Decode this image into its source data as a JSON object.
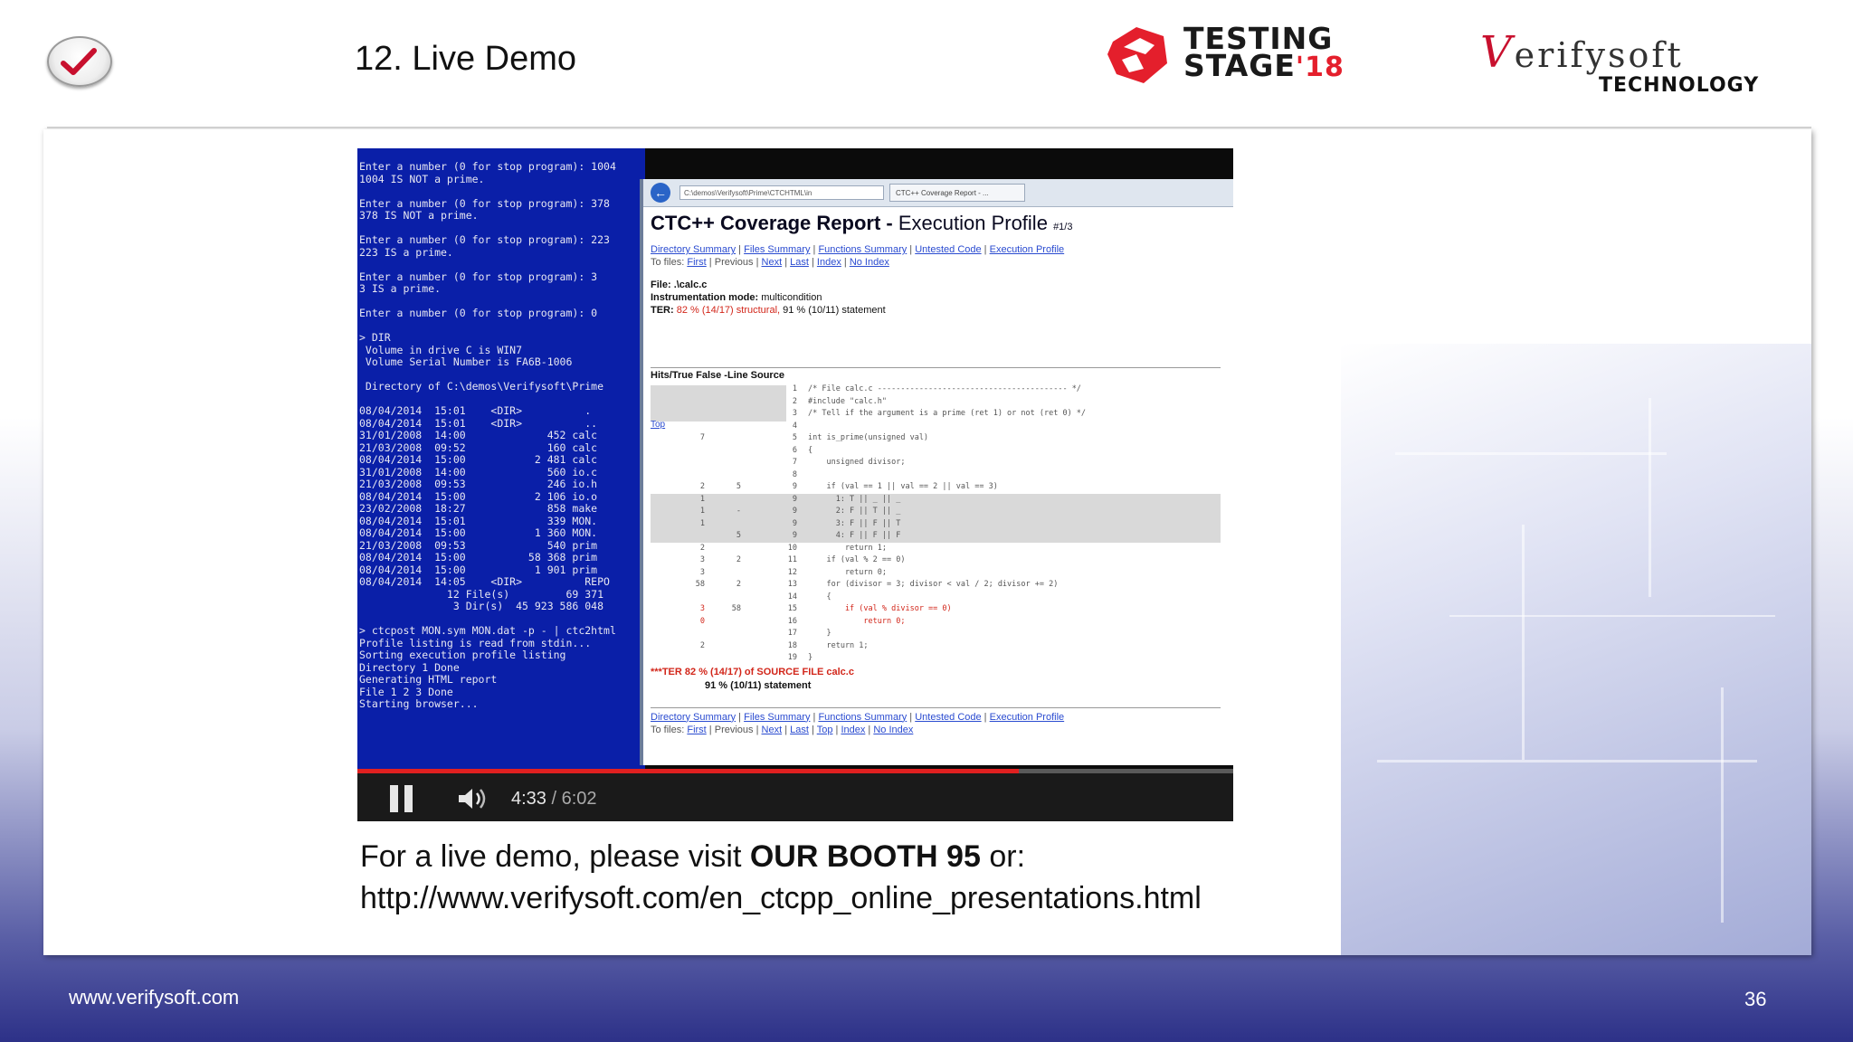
{
  "header": {
    "slide_title": "12. Live Demo",
    "testing_stage_line1": "TESTING",
    "testing_stage_line2": "STAGE",
    "testing_stage_year": "'18",
    "verifysoft_name": "erifysoft",
    "verifysoft_v": "V",
    "verifysoft_tagline": "TECHNOLOGY"
  },
  "video": {
    "terminal_lines": [
      "Enter a number (0 for stop program): 1004",
      "1004 IS NOT a prime.",
      "",
      "Enter a number (0 for stop program): 378",
      "378 IS NOT a prime.",
      "",
      "Enter a number (0 for stop program): 223",
      "223 IS a prime.",
      "",
      "Enter a number (0 for stop program): 3",
      "3 IS a prime.",
      "",
      "Enter a number (0 for stop program): 0",
      "",
      "> DIR",
      " Volume in drive C is WIN7",
      " Volume Serial Number is FA6B-1006",
      "",
      " Directory of C:\\demos\\Verifysoft\\Prime",
      "",
      "08/04/2014  15:01    <DIR>          .",
      "08/04/2014  15:01    <DIR>          ..",
      "31/01/2008  14:00             452 calc",
      "21/03/2008  09:52             160 calc",
      "08/04/2014  15:00           2 481 calc",
      "31/01/2008  14:00             560 io.c",
      "21/03/2008  09:53             246 io.h",
      "08/04/2014  15:00           2 106 io.o",
      "23/02/2008  18:27             858 make",
      "08/04/2014  15:01             339 MON.",
      "08/04/2014  15:00           1 360 MON.",
      "21/03/2008  09:53             540 prim",
      "08/04/2014  15:00          58 368 prim",
      "08/04/2014  15:00           1 901 prim",
      "08/04/2014  14:05    <DIR>          REPO",
      "              12 File(s)         69 371",
      "               3 Dir(s)  45 923 586 048",
      "",
      "> ctcpost MON.sym MON.dat -p - | ctc2html",
      "Profile listing is read from stdin...",
      "Sorting execution profile listing",
      "Directory 1 Done",
      "Generating HTML report",
      "File 1 2 3 Done",
      "Starting browser..."
    ],
    "browser_address": "C:\\demos\\Verifysoft\\Prime\\CTCHTML\\in",
    "browser_tab": "CTC++ Coverage Report - ...",
    "report_title": "CTC++ Coverage Report - ",
    "report_subtitle": "Execution Profile",
    "report_page": "#1/3",
    "nav_links": [
      "Directory Summary",
      "Files Summary",
      "Functions Summary",
      "Untested Code",
      "Execution Profile"
    ],
    "file_links": [
      "To files:",
      "First",
      "Previous",
      "Next",
      "Last",
      "Index",
      "No Index"
    ],
    "file_label": "File:",
    "file_value": ".\\calc.c",
    "instr_label": "Instrumentation mode:",
    "instr_value": "multicondition",
    "ter_label": "TER:",
    "ter_structural": "82 % (14/17) structural,",
    "ter_statement": "91 % (10/11) statement",
    "table_header": "Hits/True False -Line Source",
    "top_link": "Top",
    "code_lines": [
      {
        "hits": "",
        "false": "",
        "line": "1",
        "src": "/* File calc.c ----------------------------------------- */"
      },
      {
        "hits": "",
        "false": "",
        "line": "2",
        "src": "#include \"calc.h\""
      },
      {
        "hits": "",
        "false": "",
        "line": "3",
        "src": "/* Tell if the argument is a prime (ret 1) or not (ret 0) */"
      },
      {
        "hits": "",
        "false": "",
        "line": "4",
        "src": ""
      },
      {
        "hits": "7",
        "false": "",
        "line": "5",
        "src": "int is_prime(unsigned val)"
      },
      {
        "hits": "",
        "false": "",
        "line": "6",
        "src": "{"
      },
      {
        "hits": "",
        "false": "",
        "line": "7",
        "src": "    unsigned divisor;"
      },
      {
        "hits": "",
        "false": "",
        "line": "8",
        "src": ""
      },
      {
        "hits": "2",
        "false": "5",
        "line": "9",
        "src": "    if (val == 1 || val == 2 || val == 3)"
      },
      {
        "hits": "1",
        "false": "",
        "line": "9",
        "src": "      1: T || _ || _"
      },
      {
        "hits": "1",
        "false": "-",
        "line": "9",
        "src": "      2: F || T || _"
      },
      {
        "hits": "1",
        "false": "",
        "line": "9",
        "src": "      3: F || F || T"
      },
      {
        "hits": "",
        "false": "5",
        "line": "9",
        "src": "      4: F || F || F"
      },
      {
        "hits": "2",
        "false": "",
        "line": "10",
        "src": "        return 1;"
      },
      {
        "hits": "3",
        "false": "2",
        "line": "11",
        "src": "    if (val % 2 == 0)"
      },
      {
        "hits": "3",
        "false": "",
        "line": "12",
        "src": "        return 0;"
      },
      {
        "hits": "58",
        "false": "2",
        "line": "13",
        "src": "    for (divisor = 3; divisor < val / 2; divisor += 2)"
      },
      {
        "hits": "",
        "false": "",
        "line": "14",
        "src": "    {"
      },
      {
        "hits": "3",
        "false": "58",
        "line": "15",
        "src": "        if (val % divisor == 0)"
      },
      {
        "hits": "0",
        "false": "",
        "line": "16",
        "src": "            return 0;"
      },
      {
        "hits": "",
        "false": "",
        "line": "17",
        "src": "    }"
      },
      {
        "hits": "2",
        "false": "",
        "line": "18",
        "src": "    return 1;"
      },
      {
        "hits": "",
        "false": "",
        "line": "19",
        "src": "}"
      }
    ],
    "summary_ter": "***TER 82 % (14/17) of SOURCE FILE calc.c",
    "summary_stmt": "91 % (10/11) statement",
    "bottom_file_links": [
      "To files:",
      "First",
      "Previous",
      "Next",
      "Last",
      "Top",
      "Index",
      "No Index"
    ],
    "time_current": "4:33",
    "time_duration": "/ 6:02",
    "progress_fraction": 0.755
  },
  "caption": {
    "line1_prefix": "For a live demo, please visit ",
    "line1_bold": "OUR BOOTH 95",
    "line1_suffix": " or:",
    "line2": "http://www.verifysoft.com/en_ctcpp_online_presentations.html"
  },
  "footer": {
    "url": "www.verifysoft.com",
    "page_number": "36"
  },
  "colors": {
    "accent_red": "#e41f2c",
    "terminal_blue": "#0a1fa8",
    "footer_navy": "#2d3188",
    "progress_red": "#e02020"
  }
}
